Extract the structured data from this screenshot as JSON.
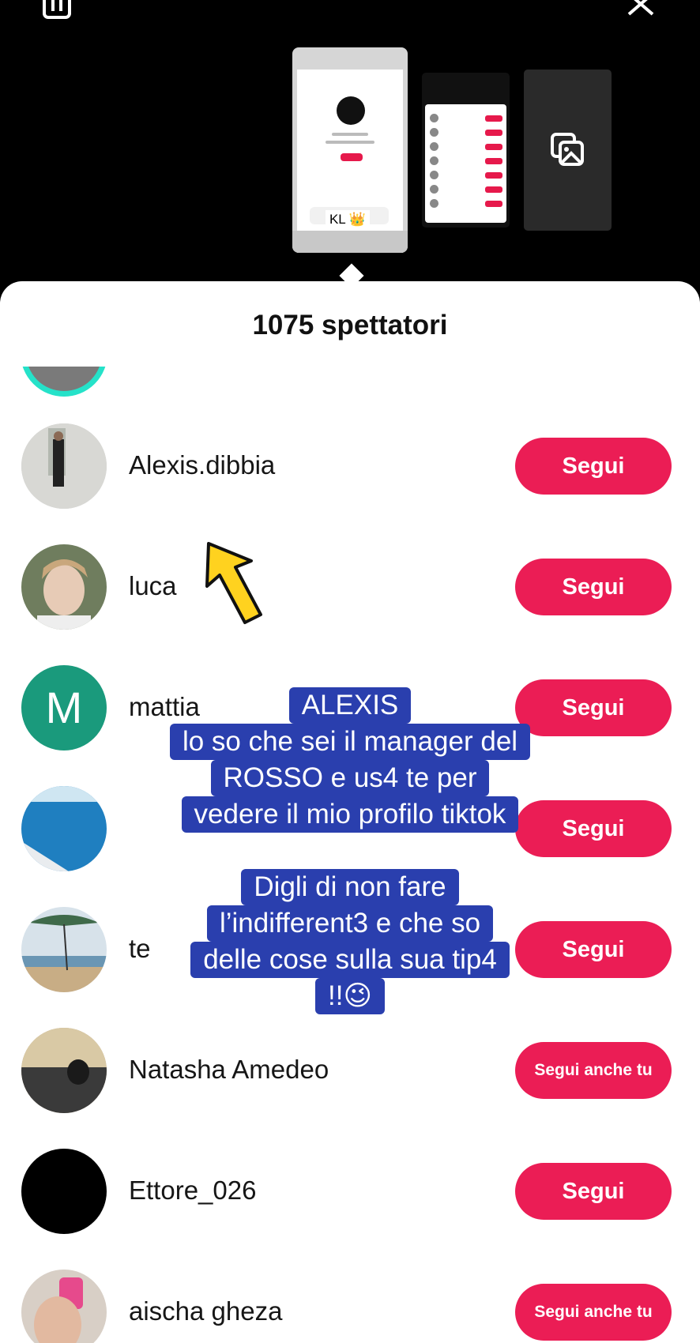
{
  "top": {
    "trash_icon": "trash-icon",
    "close_icon": "close-icon",
    "thumb_kl_text": "KL 👑",
    "gallery_icon": "gallery-icon"
  },
  "sheet": {
    "title": "1075 spettatori"
  },
  "viewers": [
    {
      "name": "Alexis.dibbia",
      "button": "Segui",
      "avatar_color": "#cfcfcf"
    },
    {
      "name": "luca",
      "button": "Segui",
      "avatar_color": "#7f8a6e"
    },
    {
      "name": "mattia",
      "button": "Segui",
      "avatar_color": "#1a9a7c",
      "avatar_letter": "M"
    },
    {
      "name": "",
      "button": "Segui",
      "avatar_color": "#1d6ea8"
    },
    {
      "name": "te",
      "button": "Segui",
      "avatar_color": "#b9a98a"
    },
    {
      "name": "Natasha Amedeo",
      "button": "Segui anche tu",
      "avatar_color": "#8a7a5e"
    },
    {
      "name": "Ettore_026",
      "button": "Segui",
      "avatar_color": "#000000"
    },
    {
      "name": "aischa gheza",
      "button": "Segui anche tu",
      "avatar_color": "#c98a8a"
    }
  ],
  "overlay": {
    "caption1": [
      "ALEXIS",
      "lo so che sei il manager del",
      "ROSSO e us4 te per",
      "vedere il mio profilo tiktok"
    ],
    "caption2": [
      "Digli di non fare",
      "l’indifferent3 e che so",
      "delle cose sulla sua tip4",
      "!!😉"
    ]
  },
  "colors": {
    "accent": "#eb1d55",
    "caption_bg": "#2a3fae",
    "ring": "#25e2c9"
  }
}
